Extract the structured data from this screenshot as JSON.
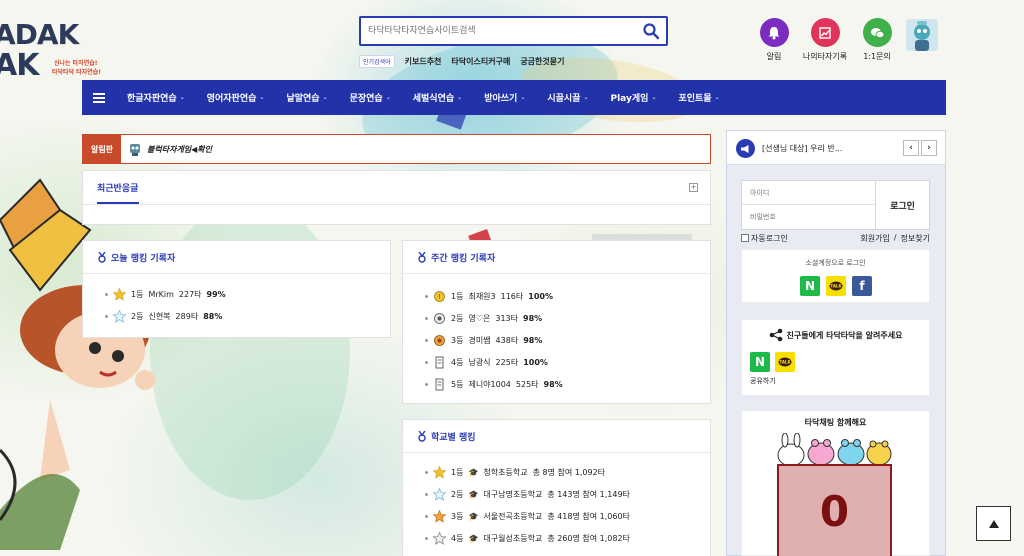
{
  "logo": {
    "line1": "ADAK",
    "line2": "AK",
    "tagline1": "신나는 타자연습!",
    "tagline2": "타닥타닥 타자연습!"
  },
  "search": {
    "placeholder": "타닥타닥타자연습사이트검색",
    "icon": "search-icon"
  },
  "popular": {
    "badge": "인기검색어",
    "keywords": [
      "키보드추천",
      "타닥이스티커구매",
      "궁금한것묻기"
    ]
  },
  "top_icons": [
    {
      "label": "알림",
      "icon": "bell-icon",
      "color": "#7b2bbf"
    },
    {
      "label": "나의타자기록",
      "icon": "chart-icon",
      "color": "#e0345a"
    },
    {
      "label": "1:1문의",
      "icon": "chat-icon",
      "color": "#3fb04a"
    }
  ],
  "nav": {
    "items": [
      "한글자판연습",
      "영어자판연습",
      "낱말연습",
      "문장연습",
      "세벌식연습",
      "받아쓰기",
      "시끌시끌",
      "Play게임",
      "포인트몰"
    ]
  },
  "notice": {
    "label": "알림판",
    "text": "블럭타자게임◀확인"
  },
  "recent": {
    "tab": "최근반응글"
  },
  "today_ranking": {
    "title": "오늘 랭킹 기록자",
    "rows": [
      {
        "rank": "1등",
        "name": "MrKim",
        "typing": "227타",
        "accuracy": "99%"
      },
      {
        "rank": "2등",
        "name": "신현복",
        "typing": "289타",
        "accuracy": "88%"
      }
    ]
  },
  "weekly_ranking": {
    "title": "주간 랭킹 기록자",
    "rows": [
      {
        "rank": "1등",
        "name": "최재원3",
        "typing": "116타",
        "accuracy": "100%"
      },
      {
        "rank": "2등",
        "name": "영♡은",
        "typing": "313타",
        "accuracy": "98%"
      },
      {
        "rank": "3등",
        "name": "경미쌤",
        "typing": "438타",
        "accuracy": "98%"
      },
      {
        "rank": "4등",
        "name": "남광식",
        "typing": "225타",
        "accuracy": "100%"
      },
      {
        "rank": "5등",
        "name": "제니야1004",
        "typing": "525타",
        "accuracy": "98%"
      }
    ]
  },
  "school_ranking": {
    "title": "학교별 랭킹",
    "rows": [
      {
        "rank": "1등",
        "school": "청학초등학교",
        "detail": "총 8명 참여 1,092타"
      },
      {
        "rank": "2등",
        "school": "대구남명초등학교",
        "detail": "총 143명 참여 1,149타"
      },
      {
        "rank": "3등",
        "school": "서울전곡초등학교",
        "detail": "총 418명 참여 1,060타"
      },
      {
        "rank": "4등",
        "school": "대구월성초등학교",
        "detail": "총 260명 참여 1,082타"
      }
    ]
  },
  "side": {
    "notice_title": "[선생님 대상] 우리 반...",
    "prev": "‹",
    "next": "›",
    "id_placeholder": "아이디",
    "pw_placeholder": "비밀번호",
    "login": "로그인",
    "auto_login": "자동로그인",
    "join": "회원가입",
    "sep": "/",
    "find": "정보찾기",
    "social_title": "소셜계정으로 로그인",
    "share_title": "친구들에게 타닥타닥을 알려주세요",
    "share_label": "공유하기",
    "chat_title": "타닥채팅 함께해요",
    "chat_count": "0"
  }
}
